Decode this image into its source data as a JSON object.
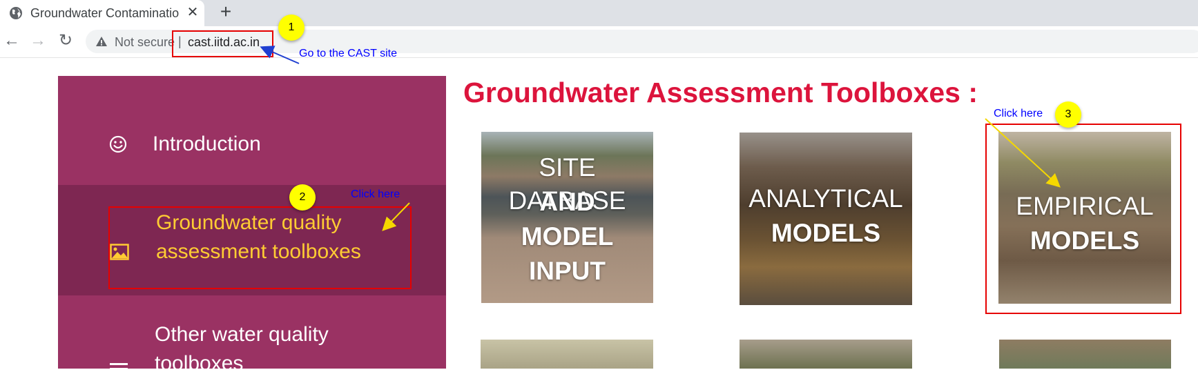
{
  "browser": {
    "tab_title": "Groundwater Contaminatio",
    "close_symbol": "✕",
    "new_tab_symbol": "+",
    "back_symbol": "←",
    "forward_symbol": "→",
    "reload_symbol": "↻",
    "security_label": "Not secure",
    "separator": "|",
    "url": "cast.iitd.ac.in"
  },
  "annotations": {
    "step1": {
      "number": "1",
      "text": "Go to the CAST site"
    },
    "step2": {
      "number": "2",
      "text": "Click here"
    },
    "step3": {
      "number": "3",
      "text": "Click here"
    },
    "box_color": "#e60000",
    "badge_color": "#ffff00",
    "text_color": "#0000ff"
  },
  "sidebar": {
    "items": [
      {
        "label": "Introduction",
        "icon": "smiley-icon"
      },
      {
        "label": "Groundwater quality assessment toolboxes",
        "line1": "Groundwater quality",
        "line2": "assessment toolboxes",
        "icon": "image-icon",
        "active": true
      },
      {
        "label": "Other water quality toolboxes",
        "line1": "Other water quality",
        "line2": "toolboxes",
        "icon": "list-icon"
      }
    ],
    "background": "#9a3263",
    "active_background": "#7e2752",
    "active_text_color": "#ffcc33"
  },
  "main": {
    "heading": "Groundwater Assessment Toolboxes :",
    "heading_color": "#dc143c",
    "cards": [
      {
        "lines": [
          "SITE DATBASE",
          "AND",
          "MODEL",
          "INPUT"
        ]
      },
      {
        "lines": [
          "ANALYTICAL",
          "MODELS"
        ]
      },
      {
        "lines": [
          "EMPIRICAL",
          "MODELS"
        ]
      }
    ]
  }
}
